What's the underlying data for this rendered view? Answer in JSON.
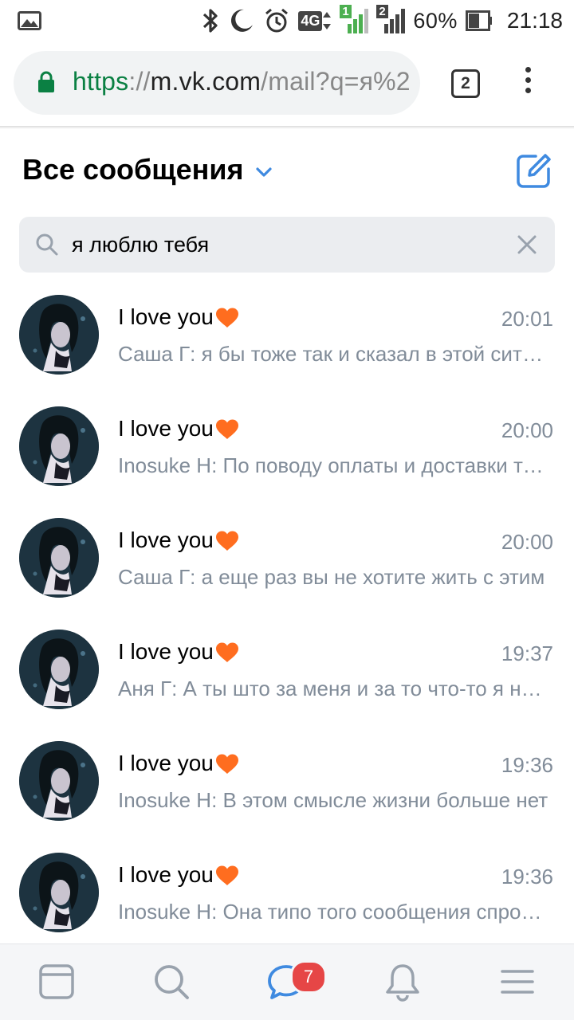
{
  "status_bar": {
    "battery": "60%",
    "time": "21:18",
    "network": "4G",
    "sim1": "1",
    "sim2": "2"
  },
  "browser": {
    "url_scheme": "https",
    "url_sep": "://",
    "url_host": "m.vk.com",
    "url_path": "/mail?q=я%2",
    "tab_count": "2"
  },
  "header": {
    "title": "Все сообщения"
  },
  "search": {
    "value": "я люблю тебя"
  },
  "conversations": [
    {
      "title": "I love you",
      "time": "20:01",
      "preview": "Саша Г: я бы тоже так и сказал в этой ситуации"
    },
    {
      "title": "I love you",
      "time": "20:00",
      "preview": "Inosuke H: По поводу оплаты и доставки товара"
    },
    {
      "title": "I love you",
      "time": "20:00",
      "preview": "Саша Г: а еще раз вы не хотите жить с этим"
    },
    {
      "title": "I love you",
      "time": "19:37",
      "preview": "Аня Г: А ты што за меня и за то что-то я не знаю"
    },
    {
      "title": "I love you",
      "time": "19:36",
      "preview": "Inosuke H: В этом смысле жизни больше нет"
    },
    {
      "title": "I love you",
      "time": "19:36",
      "preview": "Inosuke H: Она типо того сообщения спросила"
    }
  ],
  "bottom_nav": {
    "messages_badge": "7",
    "items": [
      "news-icon",
      "search-icon",
      "messages-icon",
      "bell-icon",
      "menu-icon"
    ]
  },
  "colors": {
    "accent": "#3f8ae0",
    "secure_green": "#0b8043",
    "secondary_text": "#818c99",
    "badge": "#e64646",
    "heart": "#ff6d1f"
  }
}
